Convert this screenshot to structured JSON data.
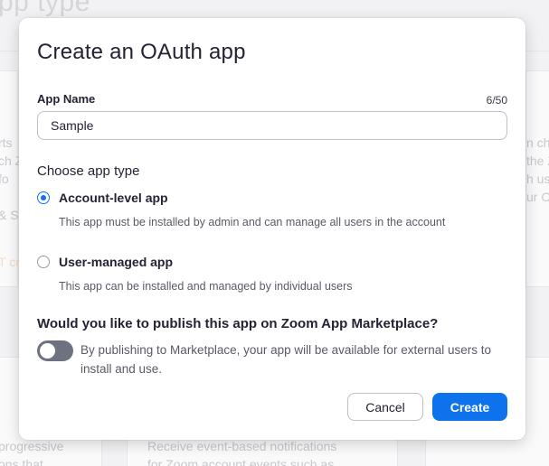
{
  "background": {
    "page_title": "pp type",
    "left_snippets": [
      "rts",
      "ch Z",
      "fo",
      "& S",
      "T cr"
    ],
    "right_snippets": [
      "n ch",
      "the Z",
      "h us",
      "ur O"
    ],
    "bottom_left": [
      "progressive",
      "ons that"
    ],
    "bottom_middle": [
      "Receive event-based notifications",
      "for Zoom account events such as"
    ]
  },
  "modal": {
    "title": "Create an OAuth app",
    "app_name": {
      "label": "App Name",
      "count": "6/50",
      "value": "Sample"
    },
    "app_type": {
      "label": "Choose app type",
      "options": [
        {
          "title": "Account-level app",
          "description": "This app must be installed by admin and can manage all users in the account",
          "selected": true
        },
        {
          "title": "User-managed app",
          "description": "This app can be installed and managed by individual users",
          "selected": false
        }
      ]
    },
    "publish": {
      "question": "Would you like to publish this app on Zoom App Marketplace?",
      "toggle_on": false,
      "description": "By publishing to Marketplace, your app will be available for external users to install and use."
    },
    "buttons": {
      "cancel": "Cancel",
      "create": "Create"
    }
  },
  "colors": {
    "accent": "#0e72ed",
    "toggle_off": "#6e7180"
  }
}
